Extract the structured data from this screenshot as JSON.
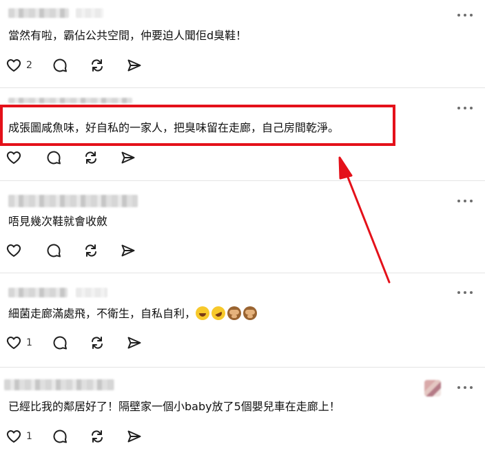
{
  "colors": {
    "highlight": "#e4111a",
    "icon": "#1f1f1f",
    "divider": "#e4e4e4"
  },
  "icons": {
    "like": "heart-icon",
    "comment": "comment-icon",
    "repost": "repost-icon",
    "share": "send-icon",
    "more": "more-icon"
  },
  "posts": [
    {
      "text": "當然有啦，霸佔公共空間，仲要迫人聞佢d臭鞋！",
      "like_count": "2"
    },
    {
      "text": "成張圖咸魚味，好自私的一家人，把臭味留在走廊，自己房間乾淨。",
      "like_count": ""
    },
    {
      "text": "唔見幾次鞋就會收斂",
      "like_count": ""
    },
    {
      "text": "細菌走廊滿處飛，不衛生，自私自利，",
      "like_count": "1"
    },
    {
      "text": "已經比我的鄰居好了！隔壁家一個小baby放了5個嬰兒車在走廊上！",
      "like_count": "1"
    }
  ]
}
